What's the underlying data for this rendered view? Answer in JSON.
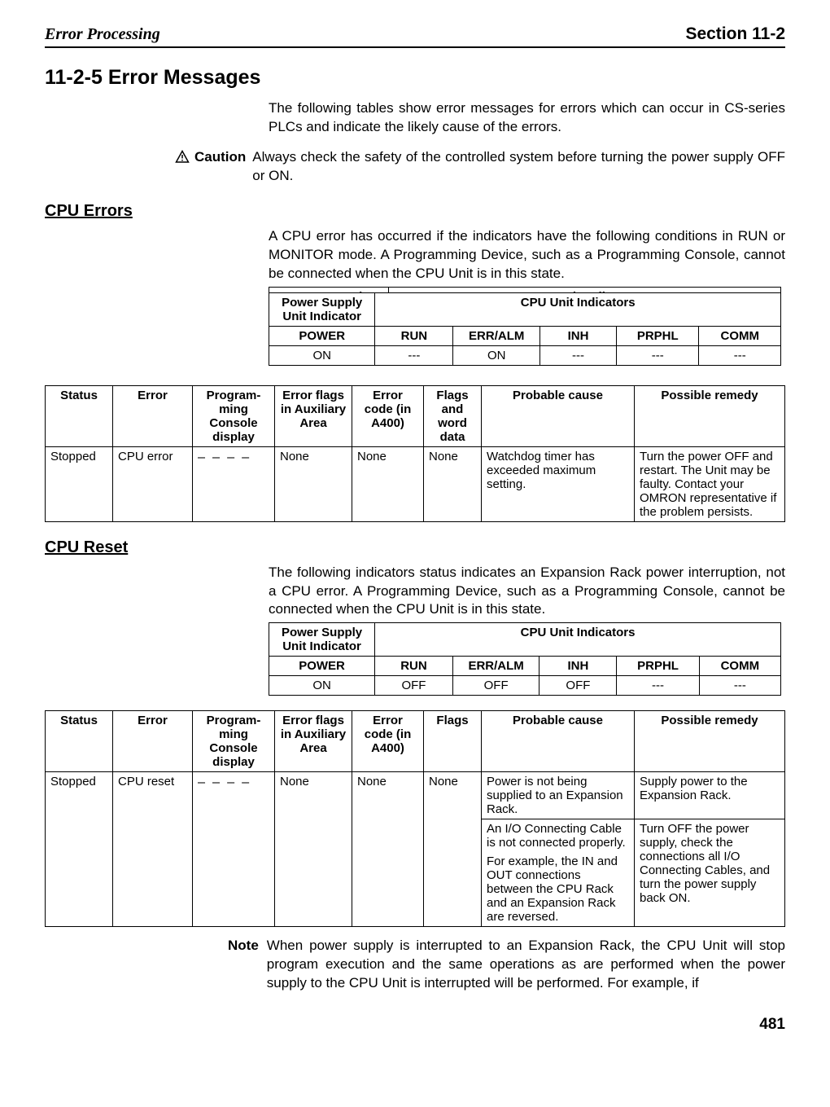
{
  "header": {
    "left": "Error Processing",
    "right": "Section 11-2"
  },
  "section": {
    "title": "11-2-5  Error Messages",
    "intro": "The following tables show error messages for errors which can occur in CS-series PLCs and indicate the likely cause of the errors.",
    "caution_label": "Caution",
    "caution_text": "Always check the safety of the controlled system before turning the power supply OFF or ON."
  },
  "cpu_errors": {
    "heading": "CPU Errors",
    "intro": "A CPU error has occurred if the indicators have the following conditions in RUN or MONITOR mode. A Programming Device, such as a Programming Console, cannot be connected when the CPU Unit is in this state.",
    "indicator_table": {
      "head1": "Power Supply Unit Indicator",
      "head2": "CPU Unit Indicators",
      "cols": [
        "POWER",
        "RUN",
        "ERR/ALM",
        "INH",
        "PRPHL",
        "COMM"
      ],
      "row": [
        "ON",
        "---",
        "ON",
        "---",
        "---",
        "---"
      ]
    },
    "status_table": {
      "headers": [
        "Status",
        "Error",
        "Program-ming Console display",
        "Error flags in Auxiliary Area",
        "Error code (in A400)",
        "Flags and word data",
        "Probable cause",
        "Possible remedy"
      ],
      "row": {
        "status": "Stopped",
        "error": "CPU error",
        "display": "– – – –",
        "flags": "None",
        "code": "None",
        "fwd": "None",
        "cause": "Watchdog timer has exceeded maximum setting.",
        "remedy": "Turn the power OFF and restart. The Unit may be faulty. Contact your OMRON representative if the problem persists."
      }
    }
  },
  "cpu_reset": {
    "heading": "CPU Reset",
    "intro": "The following indicators status indicates an Expansion Rack power interruption, not a CPU error. A Programming Device, such as a Programming Console, cannot be connected when the CPU Unit is in this state.",
    "indicator_table": {
      "head1": "Power Supply Unit Indicator",
      "head2": "CPU Unit Indicators",
      "cols": [
        "POWER",
        "RUN",
        "ERR/ALM",
        "INH",
        "PRPHL",
        "COMM"
      ],
      "row": [
        "ON",
        "OFF",
        "OFF",
        "OFF",
        "---",
        "---"
      ]
    },
    "status_table": {
      "headers": [
        "Status",
        "Error",
        "Program-ming Console display",
        "Error flags in Auxiliary Area",
        "Error code (in A400)",
        "Flags",
        "Probable cause",
        "Possible remedy"
      ],
      "row": {
        "status": "Stopped",
        "error": "CPU reset",
        "display": "– – – –",
        "flags": "None",
        "code": "None",
        "f": "None",
        "cause1": "Power is not being supplied to an Expansion Rack.",
        "remedy1": "Supply power to the Expansion Rack.",
        "cause2a": "An I/O Connecting Cable is not connected properly.",
        "cause2b": "For example, the IN and OUT connections between the CPU Rack and an Expansion Rack are reversed.",
        "remedy2": "Turn OFF the power supply, check the connections all I/O Connecting Cables, and turn the power supply back ON."
      }
    },
    "note_label": "Note",
    "note_text": "When power supply is interrupted to an Expansion Rack, the CPU Unit will stop program execution and the same operations as are performed when the power supply to the CPU Unit is interrupted will be performed. For example, if"
  },
  "pagenum": "481"
}
